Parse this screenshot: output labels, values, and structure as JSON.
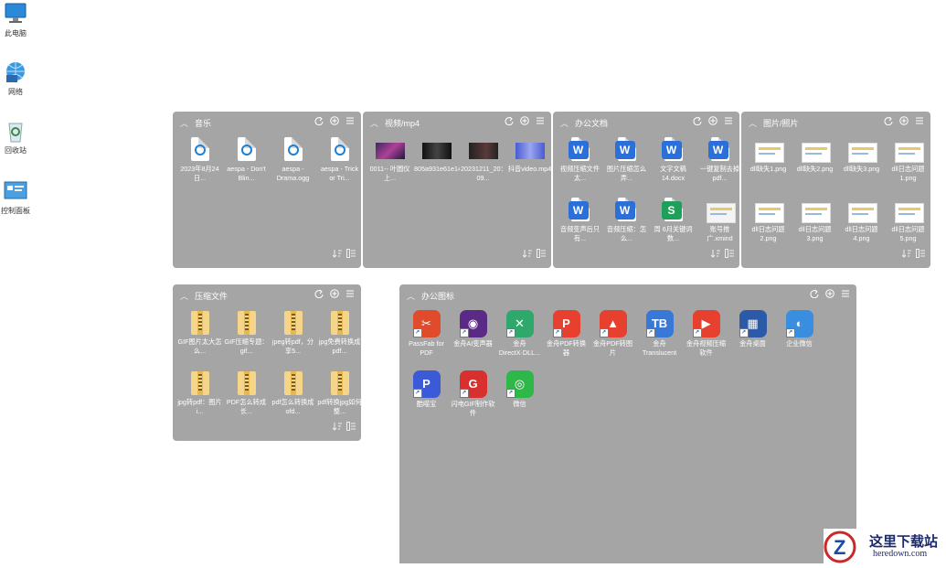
{
  "desktop": [
    {
      "label": "此电脑",
      "icon": "computer-icon"
    },
    {
      "label": "网络",
      "icon": "network-icon"
    },
    {
      "label": "回收站",
      "icon": "recycle-bin-icon"
    },
    {
      "label": "控制面板",
      "icon": "control-panel-icon"
    }
  ],
  "panels": {
    "music": {
      "title": "音乐",
      "items": [
        {
          "name": "2023年8月24日...",
          "type": "music"
        },
        {
          "name": "aespa - Don't Blin...",
          "type": "music"
        },
        {
          "name": "aespa - Drama.ogg",
          "type": "music"
        },
        {
          "name": "aespa - Trick or Tri...",
          "type": "music"
        }
      ]
    },
    "video": {
      "title": "视频/mp4",
      "items": [
        {
          "name": "0011-- 叶圆仪 上...",
          "type": "video",
          "color": "#3a2a5a"
        },
        {
          "name": "805a931e61e1440...",
          "type": "video",
          "color": "#1a1a1a"
        },
        {
          "name": "20231211_20：09...",
          "type": "video",
          "color": "#2a2a2a"
        },
        {
          "name": "抖音video.mp4",
          "type": "video",
          "color": "#5a6fd8"
        }
      ]
    },
    "office": {
      "title": "办公文档",
      "items": [
        {
          "name": "视频压缩文件太...",
          "type": "word"
        },
        {
          "name": "图片压缩怎么弄...",
          "type": "word"
        },
        {
          "name": "文字文稿14.docx",
          "type": "word"
        },
        {
          "name": "一键复制去掉pdf...",
          "type": "word"
        },
        {
          "name": "音频变声后只有...",
          "type": "word"
        },
        {
          "name": "音频压缩：怎么...",
          "type": "word"
        },
        {
          "name": "周 6月关键词数...",
          "type": "sheet"
        },
        {
          "name": "账号推广.xmind",
          "type": "mind"
        }
      ]
    },
    "pictures": {
      "title": "图片/照片",
      "items": [
        {
          "name": "dll缺失1.png",
          "type": "image"
        },
        {
          "name": "dll缺失2.png",
          "type": "image"
        },
        {
          "name": "dll缺失3.png",
          "type": "image"
        },
        {
          "name": "dll日志问题1.png",
          "type": "image"
        },
        {
          "name": "dll日志问题2.png",
          "type": "image"
        },
        {
          "name": "dll日志问题3.png",
          "type": "image"
        },
        {
          "name": "dll日志问题4.png",
          "type": "image"
        },
        {
          "name": "dll日志问题5.png",
          "type": "image"
        }
      ]
    },
    "archives": {
      "title": "压缩文件",
      "items": [
        {
          "name": "GIF图片太大怎么...",
          "type": "zip"
        },
        {
          "name": "GIF压缩专题：gif...",
          "type": "zip"
        },
        {
          "name": "jpeg转pdf，分享5...",
          "type": "zip"
        },
        {
          "name": "jpg免费转换成pdf...",
          "type": "zip"
        },
        {
          "name": "jpg转pdf：图片i...",
          "type": "zip"
        },
        {
          "name": "PDF怎么转成长...",
          "type": "zip"
        },
        {
          "name": "pdf怎么转换成ofd...",
          "type": "zip"
        },
        {
          "name": "pdf转换jpg如何整...",
          "type": "zip"
        }
      ]
    },
    "apps": {
      "title": "办公图标",
      "items": [
        {
          "name": "PassFab for PDF",
          "color": "#e04b2b",
          "glyph": "✂"
        },
        {
          "name": "金舟AI变声器",
          "color": "#5b2a86",
          "glyph": "◉"
        },
        {
          "name": "金舟DirectX·DLL...",
          "color": "#2fa86b",
          "glyph": "✕"
        },
        {
          "name": "金舟PDF转换器",
          "color": "#e8402f",
          "glyph": "P"
        },
        {
          "name": "金舟PDF转图片",
          "color": "#e8402f",
          "glyph": "▲"
        },
        {
          "name": "金舟Translucent任...",
          "color": "#3a78d8",
          "glyph": "TB"
        },
        {
          "name": "金舟视频压缩软件",
          "color": "#e8402f",
          "glyph": "▶"
        },
        {
          "name": "金舟桌面",
          "color": "#2a5aa8",
          "glyph": "▦"
        },
        {
          "name": "企业微信",
          "color": "#3a8ee0",
          "glyph": "◐"
        },
        {
          "name": "酷喵宝",
          "color": "#3a5ad8",
          "glyph": "P"
        },
        {
          "name": "闪电GIF制作软件",
          "color": "#d8302f",
          "glyph": "G"
        },
        {
          "name": "微信",
          "color": "#2fb84a",
          "glyph": "◎"
        }
      ]
    }
  },
  "watermark": {
    "title": "这里下载站",
    "url": "heredown.com"
  },
  "colors": {
    "panel": "#a5a5a5",
    "word": "#2b6fd8",
    "accent": "#1e7fd6"
  }
}
